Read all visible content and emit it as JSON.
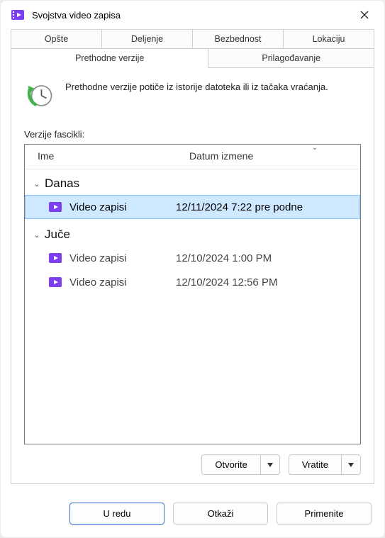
{
  "titlebar": {
    "title": "Svojstva video zapisa"
  },
  "tabs": {
    "row1": [
      {
        "label": "Opšte"
      },
      {
        "label": "Deljenje"
      },
      {
        "label": "Bezbednost"
      },
      {
        "label": "Lokaciju"
      }
    ],
    "row2": [
      {
        "label": "Prethodne verzije",
        "active": true
      },
      {
        "label": "Prilagođavanje"
      }
    ]
  },
  "info_text": "Prethodne verzije potiče iz istorije datoteka ili iz tačaka vraćanja.",
  "list": {
    "label": "Verzije fascikli:",
    "columns": {
      "name": "Ime",
      "date": "Datum izmene"
    },
    "groups": [
      {
        "title": "Danas",
        "items": [
          {
            "name": "Video zapisi",
            "date": "12/11/2024 7:22 pre podne",
            "selected": true
          }
        ]
      },
      {
        "title": "Juče",
        "items": [
          {
            "name": "Video zapisi",
            "date": "12/10/2024 1:00 PM"
          },
          {
            "name": "Video zapisi",
            "date": "12/10/2024 12:56 PM"
          }
        ]
      }
    ]
  },
  "actions": {
    "open": "Otvorite",
    "restore": "Vratite"
  },
  "dialog": {
    "ok": "U redu",
    "cancel": "Otkaži",
    "apply": "Primenite"
  }
}
